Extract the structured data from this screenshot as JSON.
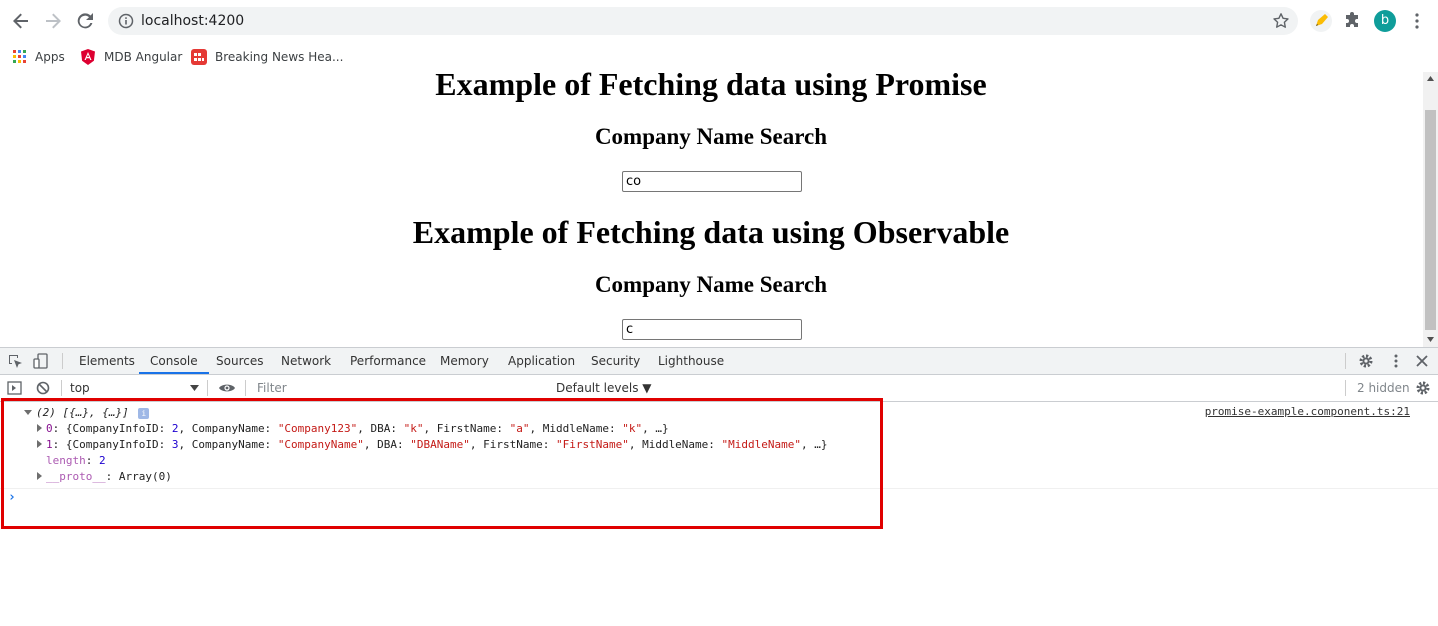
{
  "browser": {
    "url": "localhost:4200",
    "profile_initial": "b",
    "bookmarks": [
      {
        "label": "Apps",
        "icon": "apps-grid-icon"
      },
      {
        "label": "MDB Angular",
        "icon": "angular-shield-icon"
      },
      {
        "label": "Breaking News Hea...",
        "icon": "news-icon"
      }
    ]
  },
  "page": {
    "promise_heading": "Example of Fetching data using Promise",
    "promise_search_heading": "Company Name Search",
    "promise_search_value": "co",
    "observable_heading": "Example of Fetching data using Observable",
    "observable_search_heading": "Company Name Search",
    "observable_search_value": "c"
  },
  "devtools": {
    "tabs": [
      "Elements",
      "Console",
      "Sources",
      "Network",
      "Performance",
      "Memory",
      "Application",
      "Security",
      "Lighthouse"
    ],
    "active_tab": "Console",
    "context": "top",
    "filter_placeholder": "Filter",
    "levels": "Default levels ▼",
    "hidden_count": "2 hidden",
    "source_link": "promise-example.component.ts:21",
    "console": {
      "summary": "(2) [{…}, {…}]",
      "row0_index": "0",
      "row0_a": "{CompanyInfoID: ",
      "row0_id": "2",
      "row0_b": ", CompanyName: ",
      "row0_name": "\"Company123\"",
      "row0_c": ", DBA: ",
      "row0_dba": "\"k\"",
      "row0_d": ", FirstName: ",
      "row0_first": "\"a\"",
      "row0_e": ", MiddleName: ",
      "row0_middle": "\"k\"",
      "row0_f": ", …}",
      "row1_index": "1",
      "row1_a": "{CompanyInfoID: ",
      "row1_id": "3",
      "row1_b": ", CompanyName: ",
      "row1_name": "\"CompanyName\"",
      "row1_c": ", DBA: ",
      "row1_dba": "\"DBAName\"",
      "row1_d": ", FirstName: ",
      "row1_first": "\"FirstName\"",
      "row1_e": ", MiddleName: ",
      "row1_middle": "\"MiddleName\"",
      "row1_f": ", …}",
      "length_key": "length",
      "length_val": "2",
      "proto_key": "__proto__",
      "proto_val": "Array(0)",
      "prompt": "›"
    }
  },
  "colors": {
    "highlight_border": "#e00000",
    "active_tab_underline": "#1a73e8",
    "profile_avatar": "#0f9d9a"
  }
}
